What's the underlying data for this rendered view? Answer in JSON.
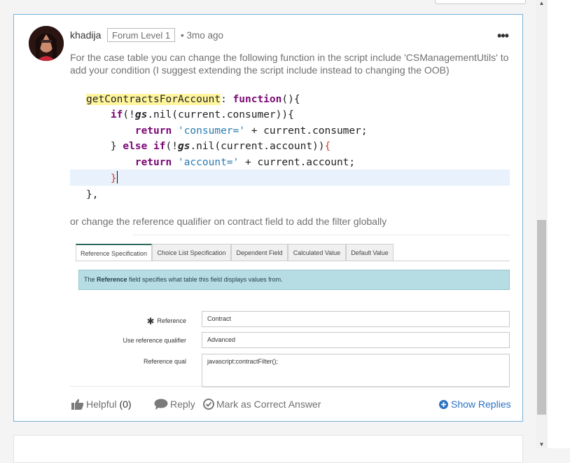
{
  "post": {
    "author": "khadija",
    "badge": "Forum Level 1",
    "time": "• 3mo ago",
    "more_menu": "•••",
    "paragraph1": "For the case table you can change the following function in the script include 'CSManagementUtils' to add your condition (I suggest extending the script include instead to changing the OOB)",
    "paragraph2": "or change the reference qualifier on contract field to add the filter globally"
  },
  "code": {
    "l1_fn": "getContractsForAccount",
    "l1_rest": ": ",
    "l1_kw": "function",
    "l1_end": "(){",
    "l2_indent": "    ",
    "l2_kw": "if",
    "l2_a": "(!",
    "l2_gs": "gs",
    "l2_b": ".nil(current.consumer)){",
    "l3_indent": "        ",
    "l3_kw": "return",
    "l3_sp": " ",
    "l3_str": "'consumer='",
    "l3_rest": " + current.consumer;",
    "l4_indent": "    ",
    "l4_a": "} ",
    "l4_kw1": "else",
    "l4_sp": " ",
    "l4_kw2": "if",
    "l4_b": "(!",
    "l4_gs": "gs",
    "l4_c": ".nil(current.account))",
    "l4_brace": "{",
    "l5_indent": "        ",
    "l5_kw": "return",
    "l5_sp": " ",
    "l5_str": "'account='",
    "l5_rest": " + current.account;",
    "l6_indent": "    ",
    "l6_brace": "}",
    "l7": "},"
  },
  "screenshot": {
    "tabs": [
      "Reference Specification",
      "Choice List Specification",
      "Dependent Field",
      "Calculated Value",
      "Default Value"
    ],
    "info_pre": "The ",
    "info_bold": "Reference",
    "info_post": " field specifies what table this field displays values from.",
    "required_mark": "✱",
    "fields": [
      {
        "label": "Reference",
        "value": "Contract"
      },
      {
        "label": "Use reference qualifier",
        "value": "Advanced"
      },
      {
        "label": "Reference qual",
        "value": "javascript:contractFilter();"
      }
    ]
  },
  "actions": {
    "helpful_label": "Helpful",
    "helpful_count": "(0)",
    "reply_label": "Reply",
    "correct_label": "Mark as Correct Answer",
    "show_replies_label": "Show Replies"
  },
  "scrollbar": {
    "up": "▲",
    "down": "▼"
  },
  "colors": {
    "accent": "#2c73c2",
    "card_border": "#79b2db",
    "code_highlight": "#e8f1fc",
    "info_bg": "#b7dde4"
  }
}
